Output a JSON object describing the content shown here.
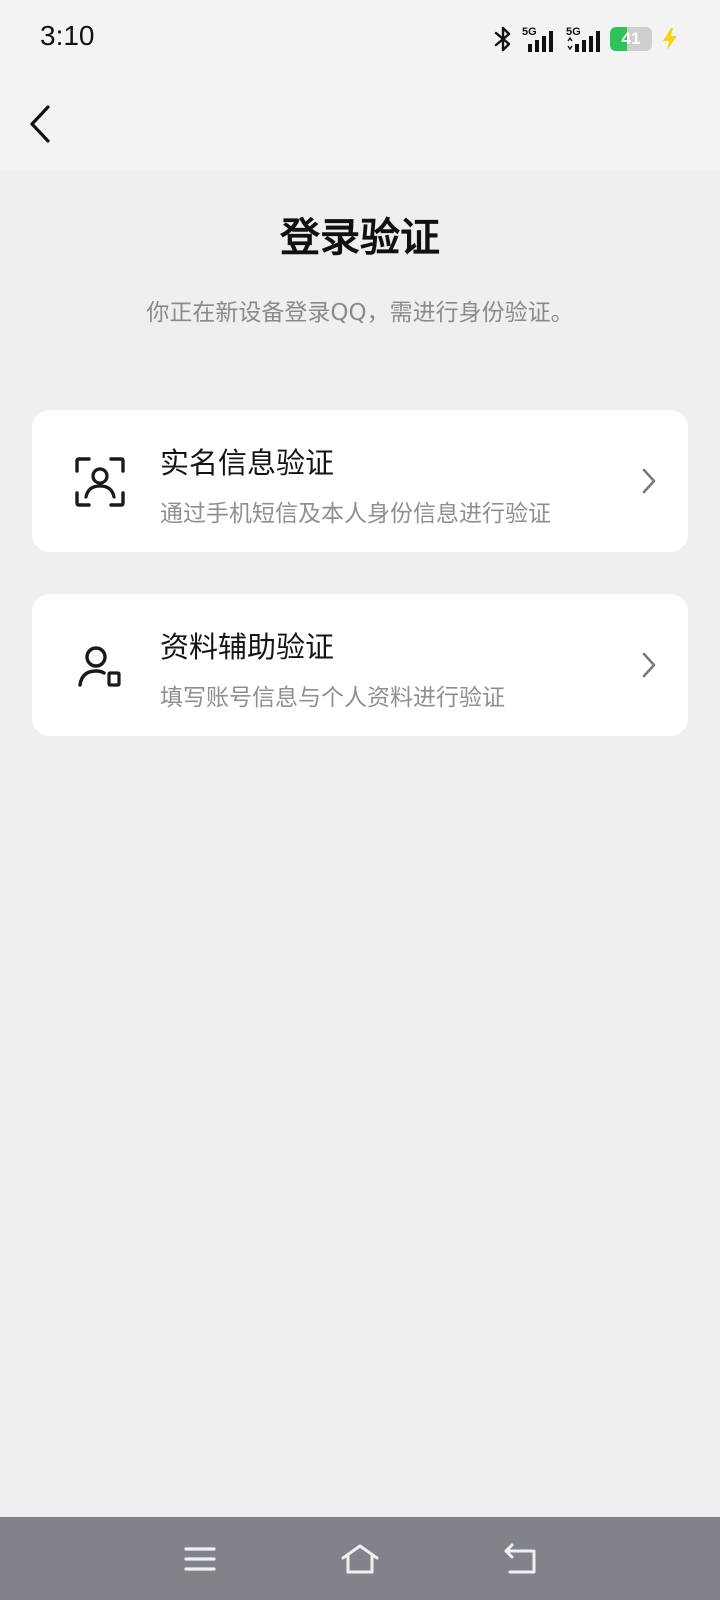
{
  "status_bar": {
    "time": "3:10",
    "network_1": "5G",
    "network_2": "5G",
    "battery_level": "41",
    "icons": [
      "bluetooth-icon",
      "signal-icon",
      "signal-icon",
      "battery-icon",
      "charging-icon"
    ]
  },
  "header": {
    "back_icon": "chevron-left-icon"
  },
  "main": {
    "title": "登录验证",
    "subtitle": "你正在新设备登录QQ，需进行身份验证。",
    "options": [
      {
        "title": "实名信息验证",
        "description": "通过手机短信及本人身份信息进行验证",
        "icon": "face-scan-icon"
      },
      {
        "title": "资料辅助验证",
        "description": "填写账号信息与个人资料进行验证",
        "icon": "user-profile-icon"
      }
    ]
  },
  "system_nav": {
    "buttons": [
      "menu-icon",
      "home-icon",
      "back-icon"
    ]
  },
  "colors": {
    "background": "#efeff2",
    "card": "#ffffff",
    "battery": "#2fc25b",
    "charging": "#f5d31a",
    "nav_bar": "#80838a"
  }
}
